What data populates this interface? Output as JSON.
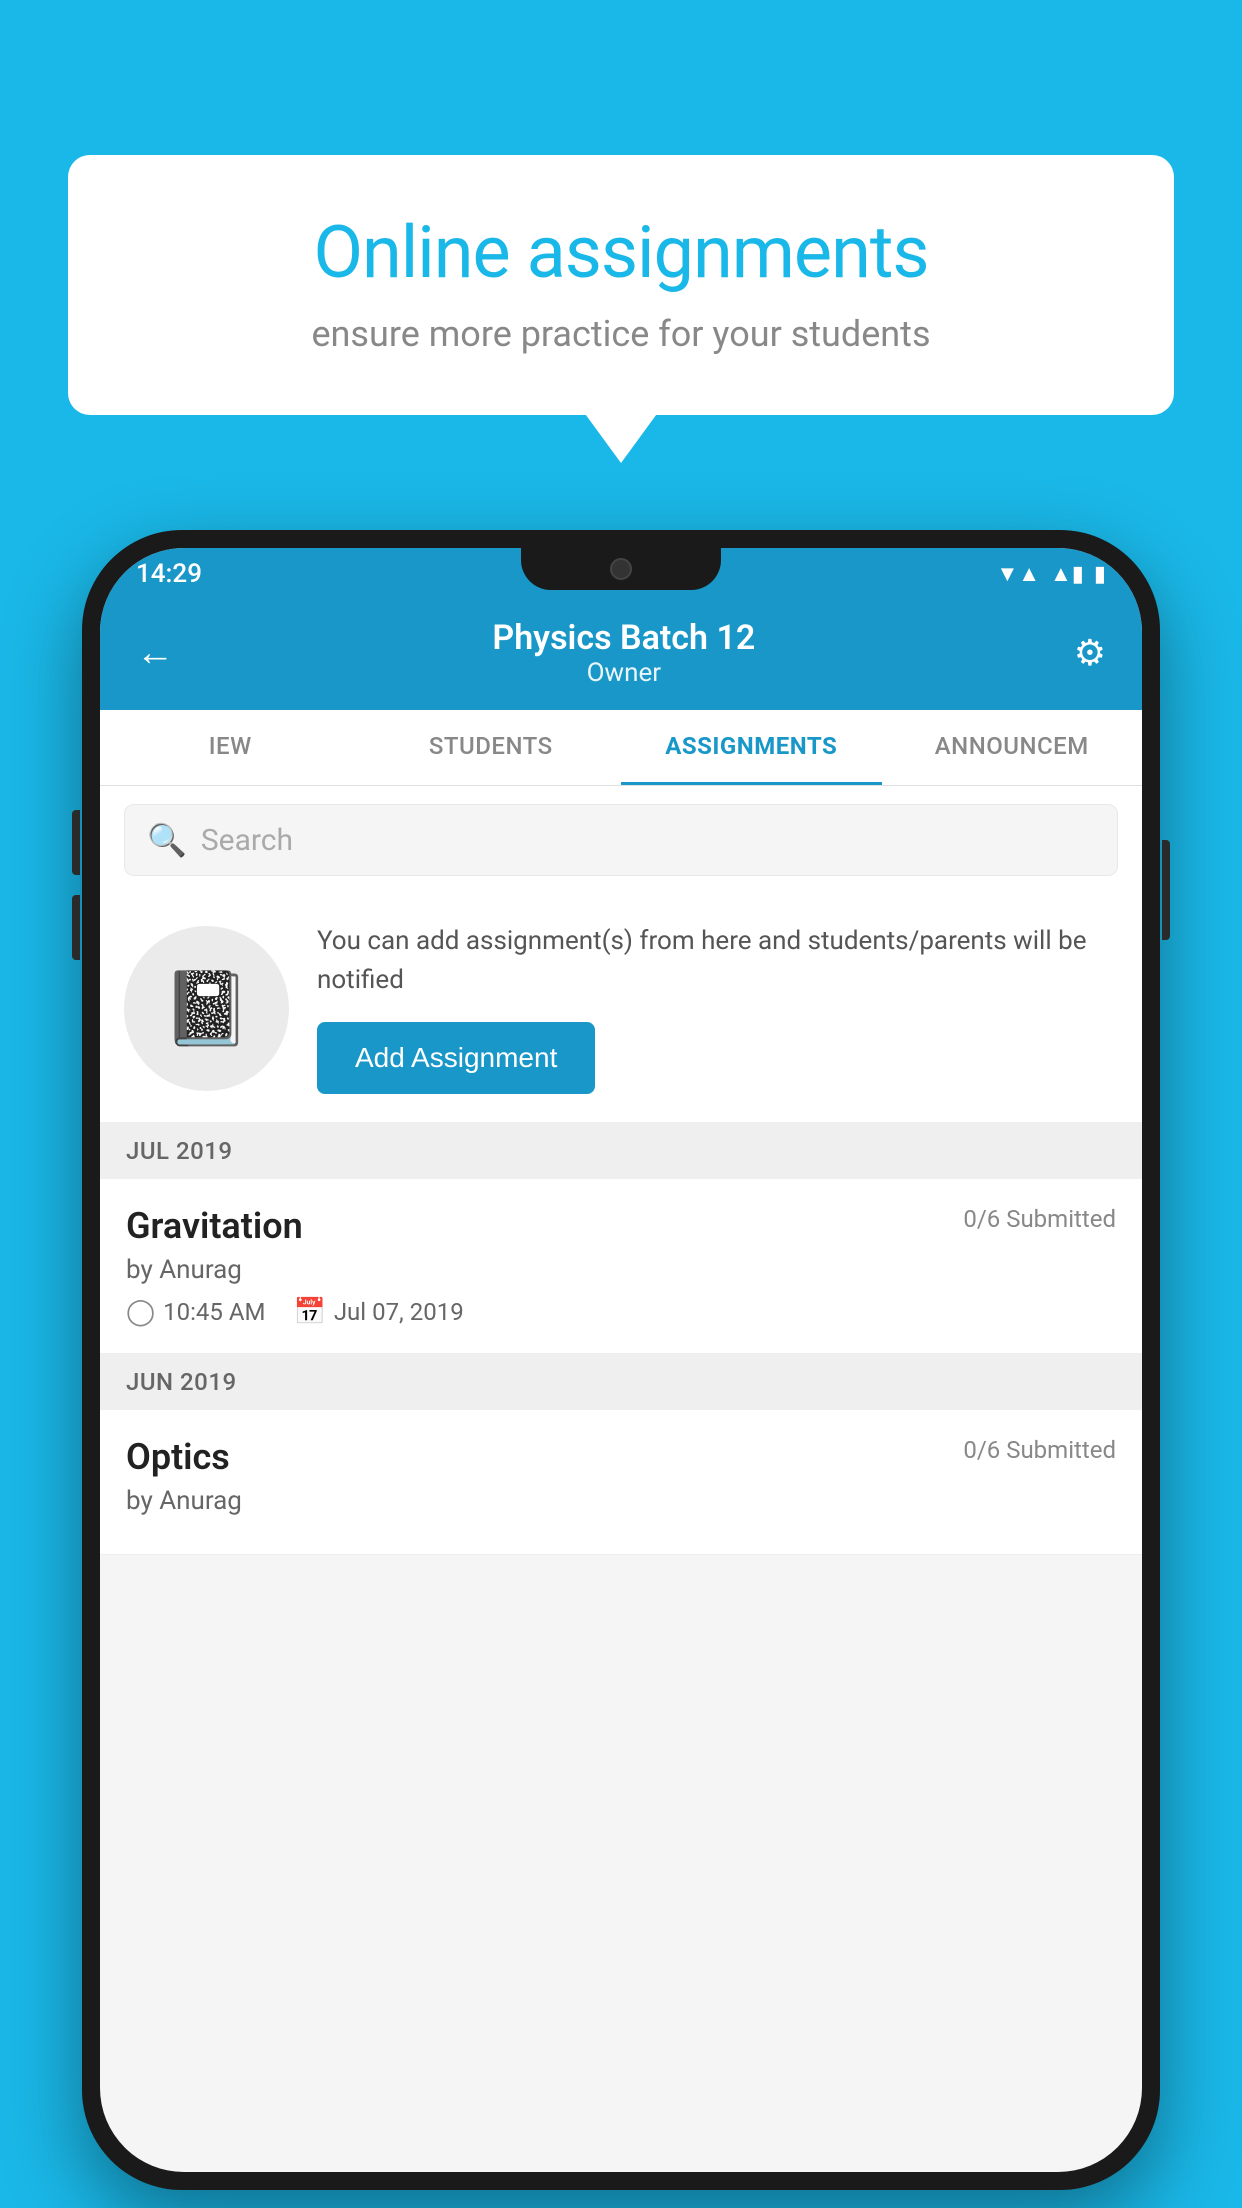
{
  "background_color": "#1ab8e8",
  "speech_bubble": {
    "title": "Online assignments",
    "subtitle": "ensure more practice for your students"
  },
  "status_bar": {
    "time": "14:29",
    "wifi_symbol": "▼",
    "signal_symbol": "▲",
    "battery_symbol": "▮"
  },
  "header": {
    "title": "Physics Batch 12",
    "subtitle": "Owner",
    "back_label": "←",
    "settings_label": "⚙"
  },
  "tabs": [
    {
      "label": "IEW",
      "active": false
    },
    {
      "label": "STUDENTS",
      "active": false
    },
    {
      "label": "ASSIGNMENTS",
      "active": true
    },
    {
      "label": "ANNOUNCEM",
      "active": false
    }
  ],
  "search": {
    "placeholder": "Search"
  },
  "add_assignment_section": {
    "info_text": "You can add assignment(s) from here and students/parents will be notified",
    "button_label": "Add Assignment"
  },
  "months": [
    {
      "label": "JUL 2019",
      "assignments": [
        {
          "name": "Gravitation",
          "submitted": "0/6 Submitted",
          "by": "by Anurag",
          "time": "10:45 AM",
          "date": "Jul 07, 2019"
        }
      ]
    },
    {
      "label": "JUN 2019",
      "assignments": [
        {
          "name": "Optics",
          "submitted": "0/6 Submitted",
          "by": "by Anurag",
          "time": "",
          "date": ""
        }
      ]
    }
  ]
}
